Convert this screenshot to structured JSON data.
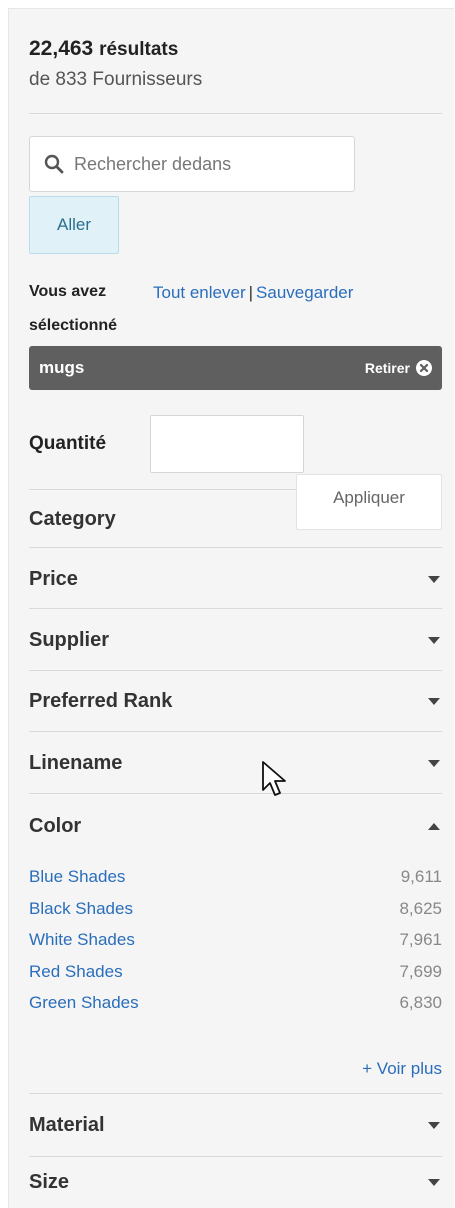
{
  "summary": {
    "count": "22,463",
    "count_suffix": "résultats",
    "suppliers": "de 833 Fournisseurs"
  },
  "search": {
    "placeholder": "Rechercher dedans",
    "value": "",
    "go_label": "Aller"
  },
  "selected": {
    "label_line1": "Vous avez",
    "label_line2": "sélectionné",
    "remove_all": "Tout enlever",
    "separator": "|",
    "save": "Sauvegarder",
    "chip": {
      "text": "mugs",
      "remove_label": "Retirer"
    }
  },
  "quantity": {
    "label": "Quantité",
    "value": "",
    "apply_label": "Appliquer"
  },
  "facets": {
    "category": "Category",
    "price": "Price",
    "supplier": "Supplier",
    "preferred_rank": "Preferred Rank",
    "linename": "Linename",
    "color": "Color",
    "material": "Material",
    "size": "Size"
  },
  "color_options": [
    {
      "name": "Blue Shades",
      "count": "9,611"
    },
    {
      "name": "Black Shades",
      "count": "8,625"
    },
    {
      "name": "White Shades",
      "count": "7,961"
    },
    {
      "name": "Red Shades",
      "count": "7,699"
    },
    {
      "name": "Green Shades",
      "count": "6,830"
    }
  ],
  "see_more": "+ Voir plus",
  "icons": {
    "search": "search-icon",
    "chip_remove": "close-circle-icon",
    "facet_toggle": "caret-down-icon",
    "pointer": "mouse-pointer-icon"
  }
}
